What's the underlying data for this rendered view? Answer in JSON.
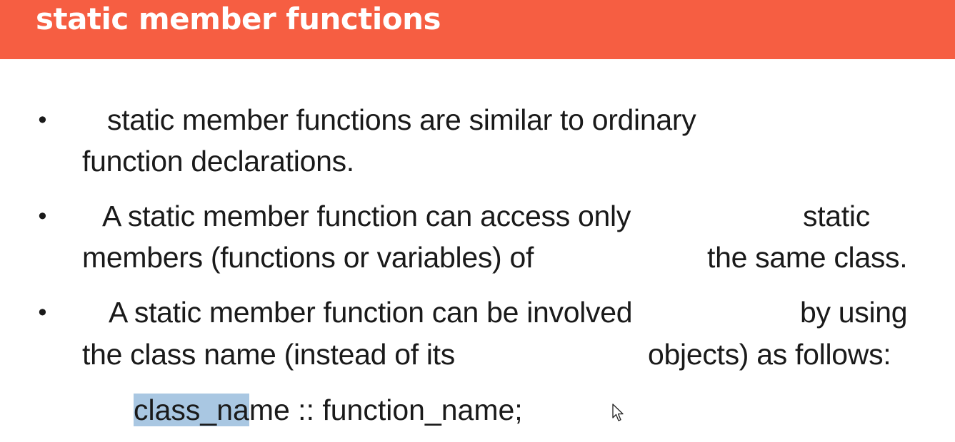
{
  "slide": {
    "title": "static member functions",
    "bullets": [
      {
        "line1": "static member functions are similar to ordinary",
        "line2": "function declarations."
      },
      {
        "line1a": "A static member function can access only",
        "line1b": "static",
        "line2a": "members (functions or variables) of",
        "line2b": "the same class."
      },
      {
        "line1a": "A static member function can be involved",
        "line1b": "by using",
        "line2a": "the class name (instead of its",
        "line2b": "objects) as follows:"
      }
    ],
    "bullet_symbol": "•",
    "code": {
      "selected_part": "class_na",
      "rest": "me :: function_name;"
    },
    "colors": {
      "title_bar": "#F65E42",
      "selection": "#A9C7E2",
      "text": "#1a1a1a"
    },
    "icons": {
      "cursor": "mouse-pointer-icon"
    }
  }
}
